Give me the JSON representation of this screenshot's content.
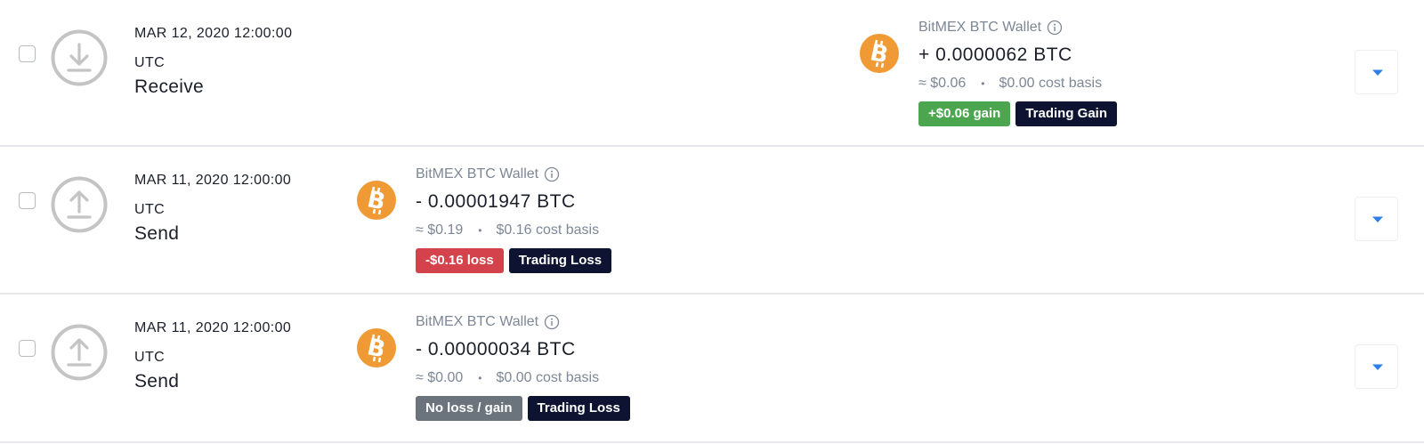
{
  "colors": {
    "btc_orange": "#f09a36",
    "gain_green": "#4ca54f",
    "loss_red": "#d4424b",
    "neutral_gray": "#6b737d",
    "tag_navy": "#0d1330",
    "caret_blue": "#2f7fe6"
  },
  "transactions": [
    {
      "date": "MAR 12, 2020 12:00:00",
      "timezone": "UTC",
      "type": "Receive",
      "type_icon": "download-icon",
      "coin_icon": "bitcoin-icon",
      "wallet": "BitMEX BTC Wallet",
      "amount": "+ 0.0000062 BTC",
      "approx_value": "≈ $0.06",
      "separator": "•",
      "cost_basis": "$0.00 cost basis",
      "result_badge": {
        "text": "+$0.06 gain",
        "kind": "gain",
        "color": "#4ca54f"
      },
      "tag_badge": {
        "text": "Trading Gain",
        "color": "#0d1330"
      }
    },
    {
      "date": "MAR 11, 2020 12:00:00",
      "timezone": "UTC",
      "type": "Send",
      "type_icon": "upload-icon",
      "coin_icon": "bitcoin-icon",
      "wallet": "BitMEX BTC Wallet",
      "amount": "- 0.00001947 BTC",
      "approx_value": "≈ $0.19",
      "separator": "•",
      "cost_basis": "$0.16 cost basis",
      "result_badge": {
        "text": "-$0.16 loss",
        "kind": "loss",
        "color": "#d4424b"
      },
      "tag_badge": {
        "text": "Trading Loss",
        "color": "#0d1330"
      }
    },
    {
      "date": "MAR 11, 2020 12:00:00",
      "timezone": "UTC",
      "type": "Send",
      "type_icon": "upload-icon",
      "coin_icon": "bitcoin-icon",
      "wallet": "BitMEX BTC Wallet",
      "amount": "- 0.00000034 BTC",
      "approx_value": "≈ $0.00",
      "separator": "•",
      "cost_basis": "$0.00 cost basis",
      "result_badge": {
        "text": "No loss / gain",
        "kind": "neutral",
        "color": "#6b737d"
      },
      "tag_badge": {
        "text": "Trading Loss",
        "color": "#0d1330"
      }
    }
  ]
}
